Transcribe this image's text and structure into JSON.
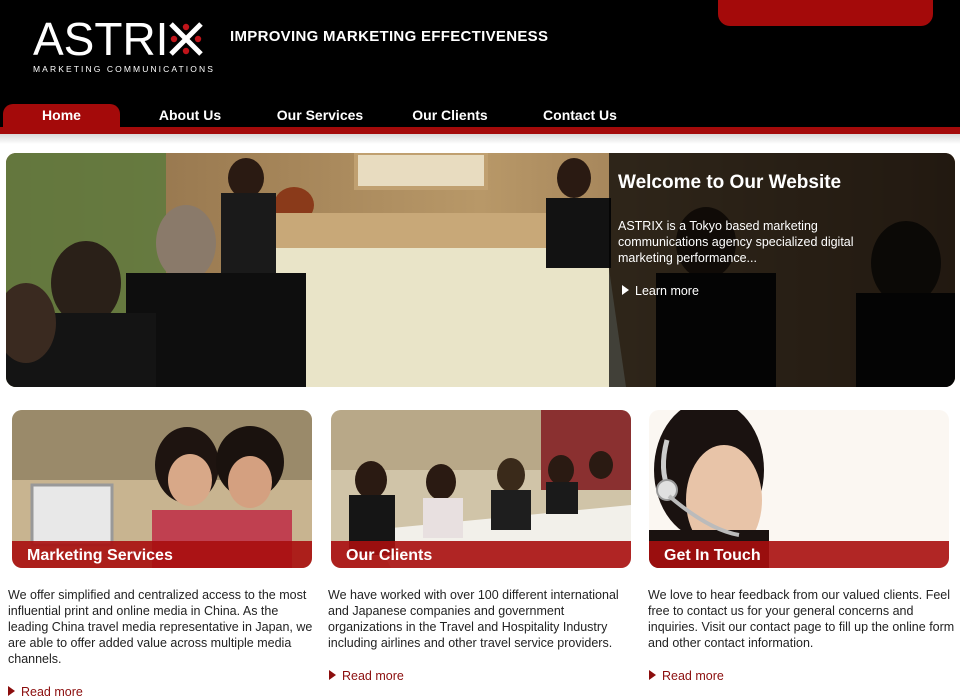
{
  "header": {
    "logo_word": "ASTRI",
    "logo_subtitle": "MARKETING COMMUNICATIONS",
    "tagline": "IMPROVING MARKETING EFFECTIVENESS"
  },
  "nav": {
    "items": [
      {
        "label": "Home",
        "active": true
      },
      {
        "label": "About Us",
        "active": false
      },
      {
        "label": "Our Services",
        "active": false
      },
      {
        "label": "Our Clients",
        "active": false
      },
      {
        "label": "Contact Us",
        "active": false
      }
    ]
  },
  "hero": {
    "title": "Welcome to Our Website",
    "text": "ASTRIX is a Tokyo based marketing communications agency specialized digital marketing performance...",
    "link": "Learn more"
  },
  "cards": [
    {
      "title": "Marketing Services",
      "text": "We offer simplified and centralized access to the most influential print and online media in China. As the leading China travel media representative in Japan, we are able to offer added value across multiple media channels.",
      "link": "Read more"
    },
    {
      "title": "Our Clients",
      "text": "We have worked with over 100 different international and Japanese companies and government organizations in the Travel and Hospitality Industry including airlines and other travel service providers.",
      "link": "Read more"
    },
    {
      "title": "Get In Touch",
      "text": "We love to hear feedback from our valued clients. Feel free to contact us for your general concerns and inquiries. Visit our contact page to fill up the online form and other contact information.",
      "link": "Read more"
    }
  ],
  "colors": {
    "brand_red": "#a40a0a",
    "header_bg": "#000000",
    "link_red": "#8b0d0d"
  }
}
